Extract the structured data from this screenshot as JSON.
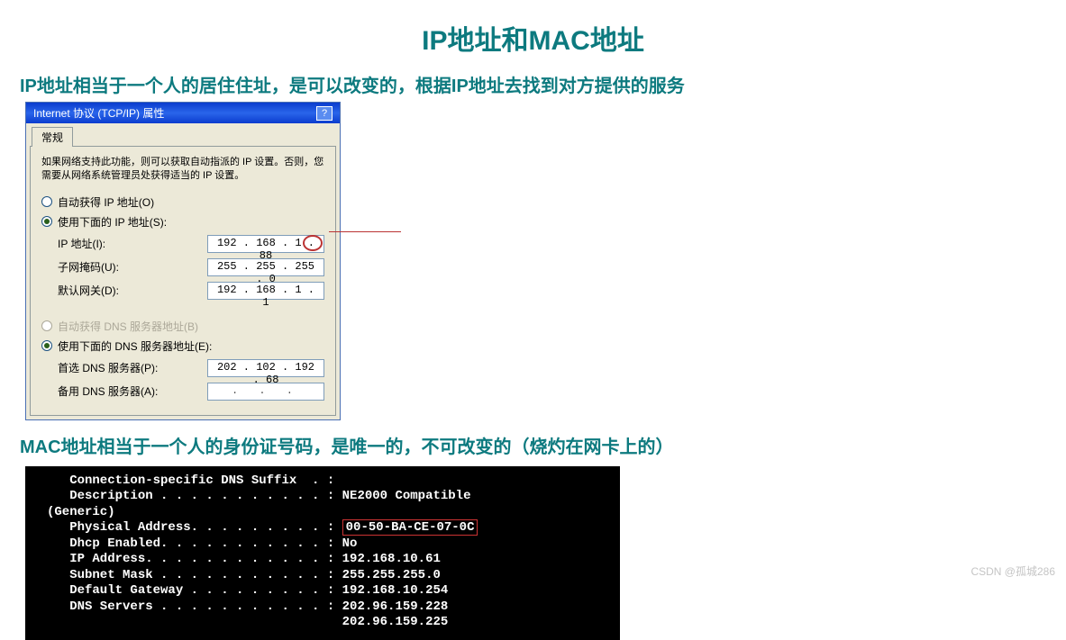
{
  "title": "IP地址和MAC地址",
  "section1": "IP地址相当于一个人的居住住址，是可以改变的，根据IP地址去找到对方提供的服务",
  "section2": "MAC地址相当于一个人的身份证号码，是唯一的，不可改变的（烧灼在网卡上的）",
  "dialog": {
    "title": "Internet 协议 (TCP/IP) 属性",
    "help": "?",
    "tab": "常规",
    "desc": "如果网络支持此功能，则可以获取自动指派的 IP 设置。否则，您需要从网络系统管理员处获得适当的 IP 设置。",
    "autoIP": "自动获得 IP 地址(O)",
    "manualIP": "使用下面的 IP 地址(S):",
    "ipLabel": "IP 地址(I):",
    "ipValue": "192 . 168 .  1  . 88",
    "subnetLabel": "子网掩码(U):",
    "subnetValue": "255 . 255 . 255 .  0",
    "gatewayLabel": "默认网关(D):",
    "gatewayValue": "192 . 168 .  1  .  1",
    "autoDNS": "自动获得 DNS 服务器地址(B)",
    "manualDNS": "使用下面的 DNS 服务器地址(E):",
    "dns1Label": "首选 DNS 服务器(P):",
    "dns1Value": "202 . 102 . 192 . 68",
    "dns2Label": "备用 DNS 服务器(A):",
    "dns2Value": "   .    .    .   "
  },
  "cmd": {
    "l1": "   Connection-specific DNS Suffix  . :",
    "l2a": "   Description . . . . . . . . . . . : NE2000 Compatible",
    "l2b": "(Generic)",
    "l3a": "   Physical Address. . . . . . . . . : ",
    "mac": "00-50-BA-CE-07-0C",
    "l4": "   Dhcp Enabled. . . . . . . . . . . : No",
    "l5": "   IP Address. . . . . . . . . . . . : 192.168.10.61",
    "l6": "   Subnet Mask . . . . . . . . . . . : 255.255.255.0",
    "l7": "   Default Gateway . . . . . . . . . : 192.168.10.254",
    "l8": "   DNS Servers . . . . . . . . . . . : 202.96.159.228",
    "l9": "                                       202.96.159.225"
  },
  "watermark": "CSDN @孤城286"
}
